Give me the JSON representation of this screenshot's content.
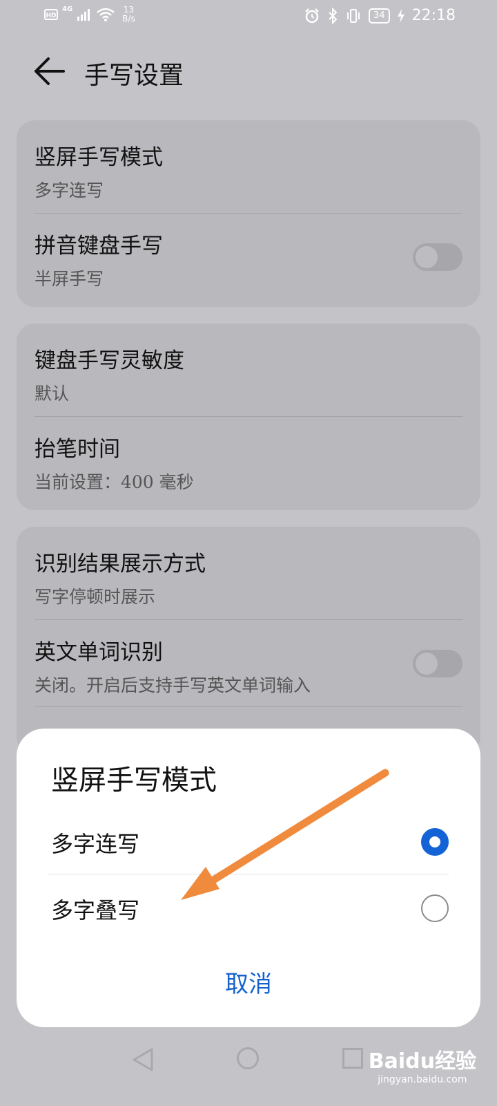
{
  "status_bar": {
    "hd": "HD",
    "signal": "4G",
    "net_speed_value": "13",
    "net_speed_unit": "B/s",
    "battery": "34",
    "time": "22:18"
  },
  "header": {
    "title": "手写设置"
  },
  "settings": {
    "group1": {
      "item1": {
        "title": "竖屏手写模式",
        "subtitle": "多字连写"
      },
      "item2": {
        "title": "拼音键盘手写",
        "subtitle": "半屏手写",
        "toggle_on": false
      }
    },
    "group2": {
      "item1": {
        "title": "键盘手写灵敏度",
        "subtitle": "默认"
      },
      "item2": {
        "title": "抬笔时间",
        "subtitle": "当前设置：400 毫秒"
      }
    },
    "group3": {
      "item1": {
        "title": "识别结果展示方式",
        "subtitle": "写字停顿时展示"
      },
      "item2": {
        "title": "英文单词识别",
        "subtitle": "关闭。开启后支持手写英文单词输入",
        "toggle_on": false
      }
    }
  },
  "dialog": {
    "title": "竖屏手写模式",
    "options": [
      {
        "label": "多字连写",
        "selected": true
      },
      {
        "label": "多字叠写",
        "selected": false
      }
    ],
    "cancel_label": "取消"
  },
  "watermark": {
    "brand": "Baidu经验",
    "url": "jingyan.baidu.com"
  },
  "colors": {
    "accent": "#1463d6",
    "annotation_arrow": "#f08a3c"
  }
}
